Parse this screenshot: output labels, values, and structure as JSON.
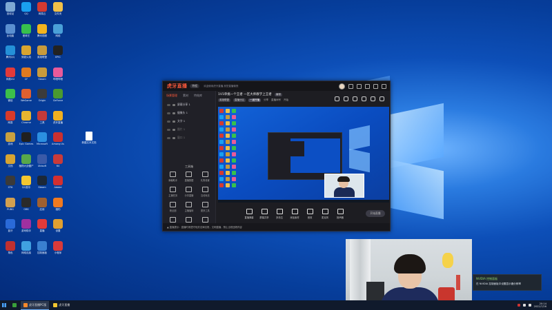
{
  "desktop": {
    "icons": [
      {
        "label": "回收站",
        "color": "#7ea9d4"
      },
      {
        "label": "QQ",
        "color": "#1aa0f0"
      },
      {
        "label": "网易云",
        "color": "#d33a31"
      },
      {
        "label": "文件夹",
        "color": "#f0c048"
      },
      {
        "label": "此电脑",
        "color": "#5a8fd0"
      },
      {
        "label": "爱奇艺",
        "color": "#37c14d"
      },
      {
        "label": "腾讯视频",
        "color": "#f3b41e"
      },
      {
        "label": "网络",
        "color": "#4aa0d8"
      },
      {
        "label": "腾讯QQ",
        "color": "#2490d8"
      },
      {
        "label": "穿越火线",
        "color": "#d8a430"
      },
      {
        "label": "英雄联盟",
        "color": "#c89b3c"
      },
      {
        "label": "EPIC",
        "color": "#222222"
      },
      {
        "label": "网易UU",
        "color": "#e23a3a"
      },
      {
        "label": "CF",
        "color": "#e07a20"
      },
      {
        "label": "Steam",
        "color": "#c89b3c"
      },
      {
        "label": "哔哩哔哩",
        "color": "#e85a9a"
      },
      {
        "label": "微信",
        "color": "#3cbf4a"
      },
      {
        "label": "WeGame",
        "color": "#e06030"
      },
      {
        "label": "Origin",
        "color": "#3b3b3b"
      },
      {
        "label": "GeForce",
        "color": "#4a9a30"
      },
      {
        "label": "网易",
        "color": "#d83a2a"
      },
      {
        "label": "Chrome",
        "color": "#e8b530"
      },
      {
        "label": "工具",
        "color": "#c33a3a"
      },
      {
        "label": "虎牙直播",
        "color": "#f0b020"
      },
      {
        "label": "游戏",
        "color": "#c8a040"
      },
      {
        "label": "Epic Games",
        "color": "#202020"
      },
      {
        "label": "Microsoft Edge",
        "color": "#2b8fe0"
      },
      {
        "label": "Among Us",
        "color": "#c93030"
      },
      {
        "label": "文档",
        "color": "#d7a431"
      },
      {
        "label": "植物大战僵尸",
        "color": "#58a84a"
      },
      {
        "label": "Ubisoft",
        "color": "#3a5aa8"
      },
      {
        "label": "64",
        "color": "#c83a3a"
      },
      {
        "label": "GTA",
        "color": "#3a3a3a"
      },
      {
        "label": "QQ音乐",
        "color": "#f3c630"
      },
      {
        "label": "Steam",
        "color": "#1b2838"
      },
      {
        "label": "Adobe",
        "color": "#d32f2f"
      },
      {
        "label": "PUBG",
        "color": "#d2a050"
      },
      {
        "label": "OBS",
        "color": "#2a2a2a"
      },
      {
        "label": "应用",
        "color": "#a06030"
      },
      {
        "label": "猎豹",
        "color": "#f07a20"
      },
      {
        "label": "蓝牙",
        "color": "#2a6ad8"
      },
      {
        "label": "游戏助手",
        "color": "#a030a0"
      },
      {
        "label": "直播",
        "color": "#e03a3a"
      },
      {
        "label": "设置",
        "color": "#e0a030"
      },
      {
        "label": "角色",
        "color": "#c03030"
      },
      {
        "label": "网络连接",
        "color": "#40a0e0"
      },
      {
        "label": "控制面板",
        "color": "#3a80d0"
      },
      {
        "label": "小程序",
        "color": "#d83a3a"
      }
    ],
    "file": {
      "label": "新建文本文档"
    }
  },
  "app": {
    "logo": "虎牙直播",
    "version_chip": "特权",
    "notice": "欢迎使用虎牙直播,祝您直播愉快",
    "sidebar_tabs": [
      "场景管理",
      "素材",
      "特效库"
    ],
    "scenes": [
      "屏幕分享 1",
      "摄像头 1",
      "文字 1",
      "图片 1",
      "窗口 1"
    ],
    "tools_title": "工具箱",
    "tools": [
      "弹幕助手",
      "直播数据",
      "礼物设置",
      "主播任务",
      "分享直播",
      "互动玩法",
      "粉丝团",
      "主播福利",
      "更多工具",
      "抽奖",
      "房管",
      "设置"
    ],
    "stream_title": "1V1单挑一个王者 一区大师教学上王者",
    "stream_title_chip": "编辑",
    "stream_sub": [
      "英雄联盟",
      "直播分区",
      "一键开播",
      "分享",
      "直播间号",
      "开始"
    ],
    "controls": [
      "直播弹幕",
      "屏幕共享",
      "多机位",
      "添加素材",
      "音效",
      "麦克风",
      "扬声器"
    ],
    "start_button": "开始直播",
    "status_text": "▲ 直播提示：直播时请遵守相关法律法规，文明直播，禁止出现违规内容"
  },
  "notification": {
    "title": "NVIDIA 控制面板",
    "body": "在 NVIDIA 控制面板中设置显示器分辨率"
  },
  "taskbar": {
    "items": [
      {
        "label": "",
        "color": "#3aa03a"
      },
      {
        "label": "虎牙直播PC版",
        "color": "#ff8a2a"
      },
      {
        "label": "虎牙直播",
        "color": "#f3c630"
      }
    ],
    "time": "20:14",
    "date": "2022/7/26"
  }
}
